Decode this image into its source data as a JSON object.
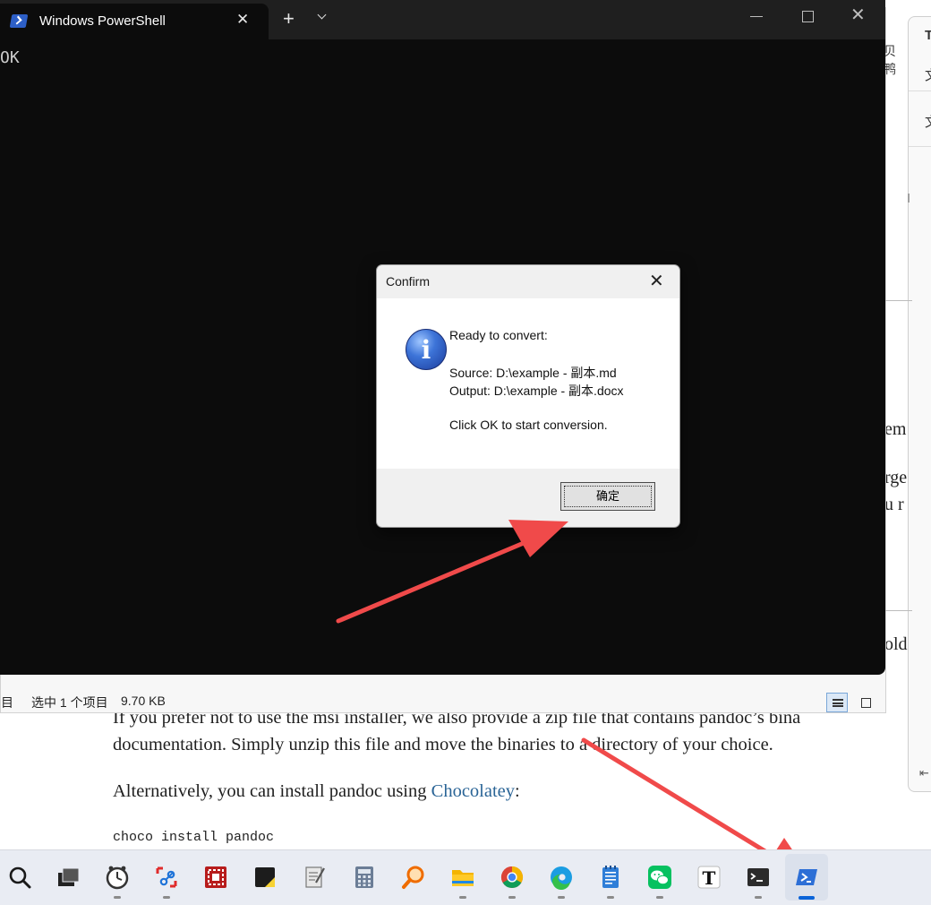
{
  "web": {
    "para1_line1": "If you prefer not to use the msi installer, we also provide a zip file that contains pandoc’s bina",
    "para1_line2": "documentation. Simply unzip this file and move the binaries to a directory of your choice.",
    "para2_prefix": "Alternatively, you can install pandoc using ",
    "para2_link": "Chocolatey",
    "para2_suffix": ":",
    "code": "choco install pandoc",
    "frag_em": "em",
    "frag_rge": "rge",
    "frag_u": "u r",
    "frag_old": "old"
  },
  "side_panel": {
    "frag_top": "T",
    "frag_a": "文",
    "frag_b": "文",
    "frag_c": "I"
  },
  "explorer": {
    "top_frag": "贝鸭",
    "status_left": "目",
    "status_selected": "选中 1 个项目",
    "status_size": "9.70 KB"
  },
  "terminal": {
    "tab_title": "Windows PowerShell",
    "output_text": "OK"
  },
  "dialog": {
    "title": "Confirm",
    "line1": "Ready to convert:",
    "line2": "Source: D:\\example - 副本.md",
    "line3": "Output: D:\\example - 副本.docx",
    "line4": "Click OK to start conversion.",
    "ok_label": "确定"
  },
  "colors": {
    "arrow": "#f04a4a",
    "accent_blue": "#0a63d8",
    "terminal_bg": "#0c0c0c"
  },
  "taskbar": {
    "icons": [
      "search-icon",
      "task-view-icon",
      "clock-icon",
      "snipping-tool-icon",
      "screen-recorder-icon",
      "sticky-notes-icon",
      "notepad-icon",
      "calculator-icon",
      "everything-search-icon",
      "file-explorer-icon",
      "chrome-icon",
      "edge-icon",
      "notepad-app-icon",
      "wechat-icon",
      "typora-icon",
      "terminal-icon",
      "powershell-icon"
    ]
  }
}
